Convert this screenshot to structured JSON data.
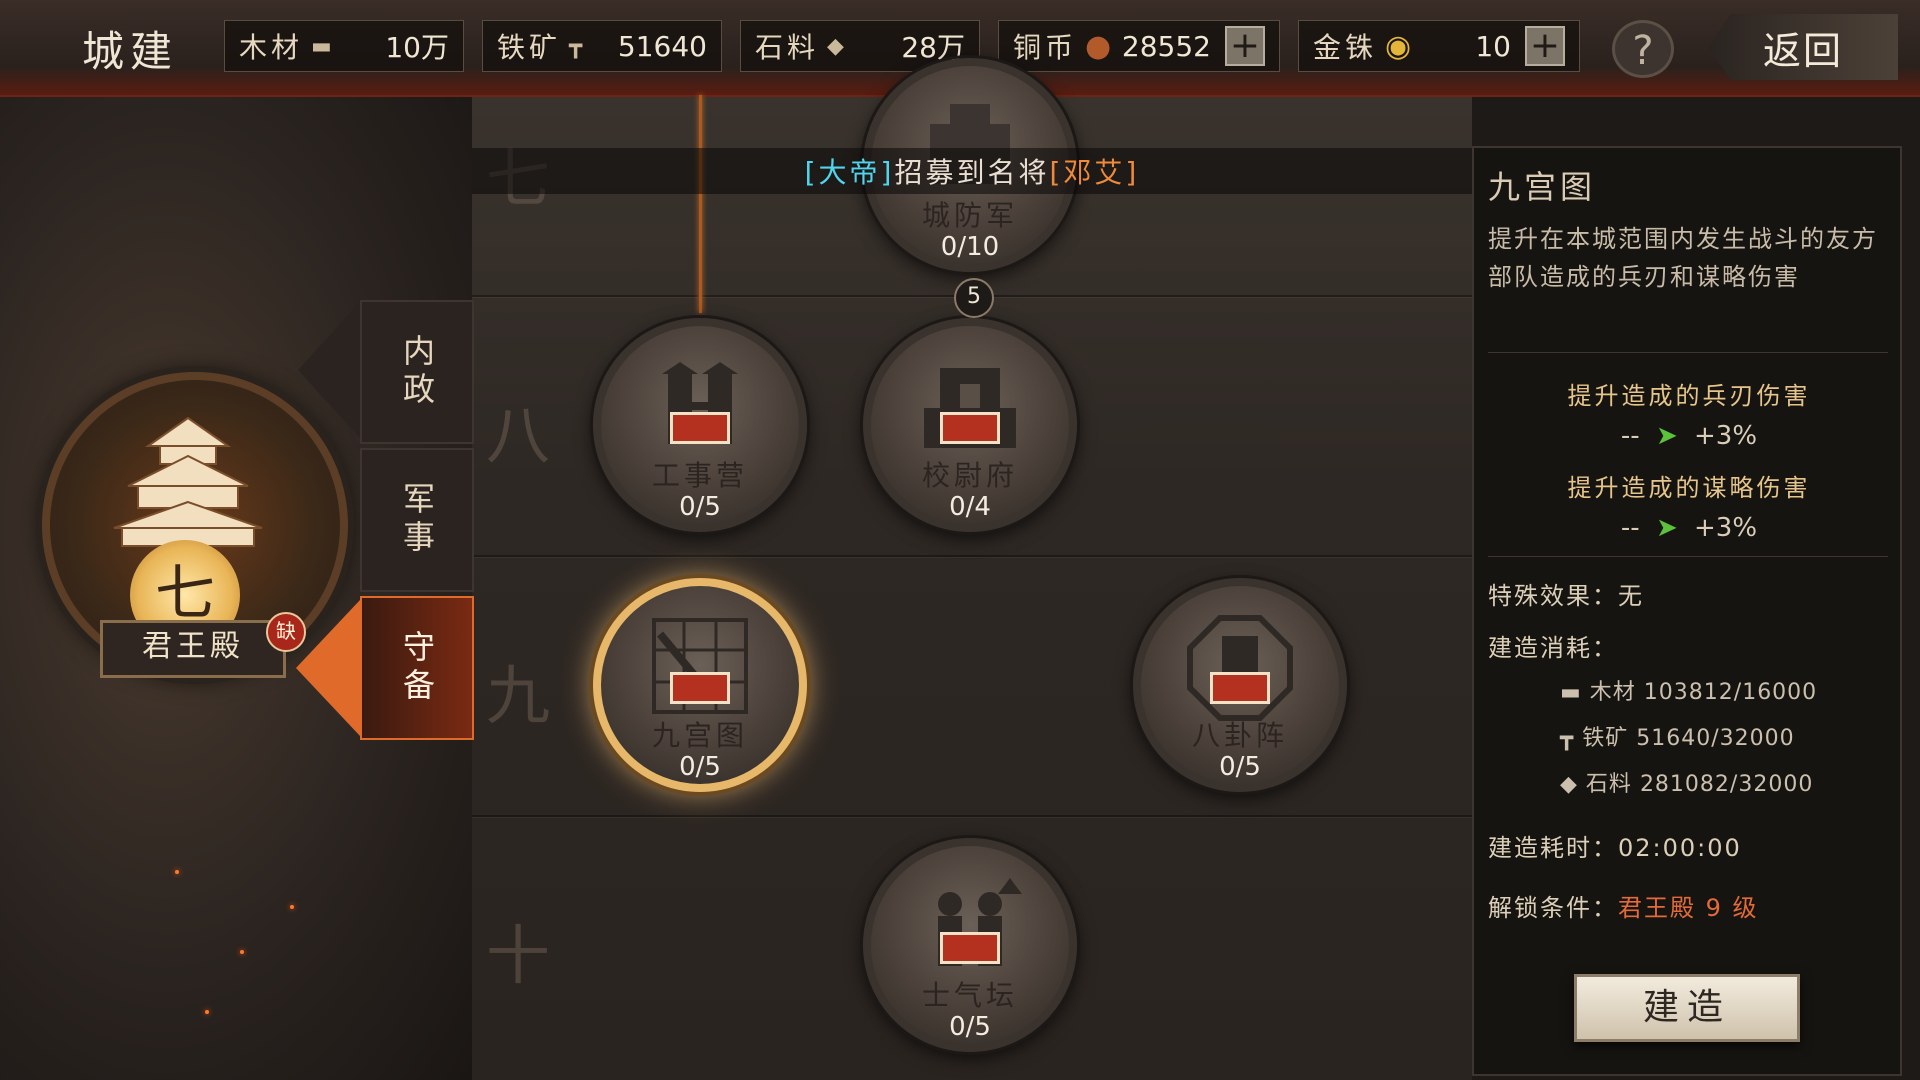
{
  "header": {
    "title": "城建",
    "resources": [
      {
        "label": "木材",
        "icon": "wood-icon",
        "value": "10万"
      },
      {
        "label": "铁矿",
        "icon": "iron-icon",
        "value": "51640"
      },
      {
        "label": "石料",
        "icon": "stone-icon",
        "value": "28万"
      },
      {
        "label": "铜币",
        "icon": "copper-coin-icon",
        "value": "28552"
      },
      {
        "label": "金铢",
        "icon": "gold-coin-icon",
        "value": "10"
      }
    ],
    "help_label": "?",
    "back_label": "返回"
  },
  "sidebar": {
    "building_level": "七",
    "building_name": "君王殿",
    "lack_badge": "缺",
    "tabs": [
      "内政",
      "军事",
      "守备"
    ],
    "active_tab": "守备"
  },
  "tiers": [
    "七",
    "八",
    "九",
    "十"
  ],
  "notice": {
    "part1": "[大帝]",
    "part2": "招募到名将",
    "part3": "[邓艾]"
  },
  "buildings": [
    {
      "name": "城防军",
      "progress": "0/10"
    },
    {
      "name": "工事营",
      "progress": "0/5"
    },
    {
      "name": "校尉府",
      "progress": "0/4"
    },
    {
      "name": "九宫图",
      "progress": "0/5",
      "selected": true
    },
    {
      "name": "八卦阵",
      "progress": "0/5"
    },
    {
      "name": "士气坛",
      "progress": "0/5"
    }
  ],
  "requirement_badge": "5",
  "detail": {
    "title": "九宫图",
    "description": "提升在本城范围内发生战斗的友方部队造成的兵刃和谋略伤害",
    "stats": [
      {
        "title": "提升造成的兵刃伤害",
        "current": "--",
        "next": "+3%"
      },
      {
        "title": "提升造成的谋略伤害",
        "current": "--",
        "next": "+3%"
      }
    ],
    "special_label": "特殊效果：",
    "special_value": "无",
    "cost_label": "建造消耗：",
    "costs": [
      {
        "name": "木材",
        "value": "103812/16000"
      },
      {
        "name": "铁矿",
        "value": "51640/32000"
      },
      {
        "name": "石料",
        "value": "281082/32000"
      }
    ],
    "time_label": "建造耗时：",
    "time_value": "02:00:00",
    "unlock_label": "解锁条件：",
    "unlock_value": "君王殿 9 级",
    "build_button": "建造"
  },
  "colors": {
    "accent_orange": "#e06a2a",
    "notice_cyan": "#4fd6ee",
    "notice_orange": "#ee8a3a",
    "arrow_green": "#5cc23a",
    "unlock_red": "#e46a3a"
  }
}
